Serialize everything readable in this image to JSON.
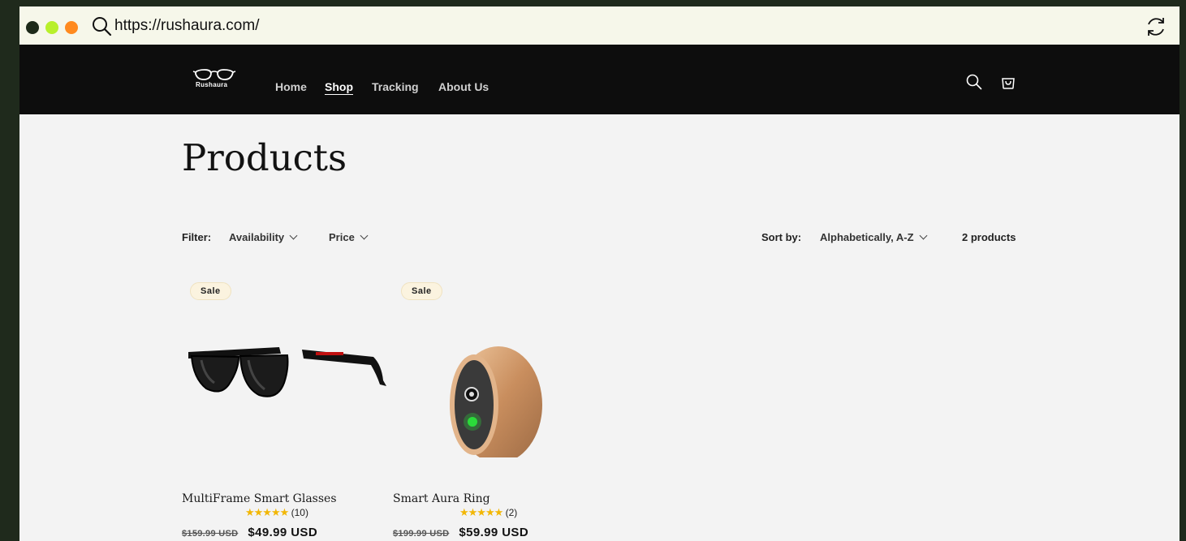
{
  "browser": {
    "url": "https://rushaura.com/"
  },
  "header": {
    "logo_text": "Rushaura",
    "nav": [
      "Home",
      "Shop",
      "Tracking",
      "About Us"
    ],
    "active_nav": "Shop"
  },
  "page": {
    "title": "Products"
  },
  "facets": {
    "filter_label": "Filter:",
    "filters": [
      "Availability",
      "Price"
    ],
    "sort_label": "Sort by:",
    "sort_value": "Alphabetically, A-Z",
    "count": "2 products"
  },
  "products": [
    {
      "badge": "Sale",
      "name": "MultiFrame Smart Glasses",
      "stars": "★★★★★",
      "reviews": "(10)",
      "old_price": "$159.99 USD",
      "price": "$49.99 USD",
      "image": "smart-glasses-image"
    },
    {
      "badge": "Sale",
      "name": "Smart Aura Ring",
      "stars": "★★★★★",
      "reviews": "(2)",
      "old_price": "$199.99 USD",
      "price": "$59.99 USD",
      "image": "smart-ring-image"
    }
  ],
  "icons": {
    "address_bar": "search-icon",
    "reload": "reload-icon",
    "header_search": "search-icon",
    "cart": "cart-icon",
    "star_color": "#f2b705"
  }
}
